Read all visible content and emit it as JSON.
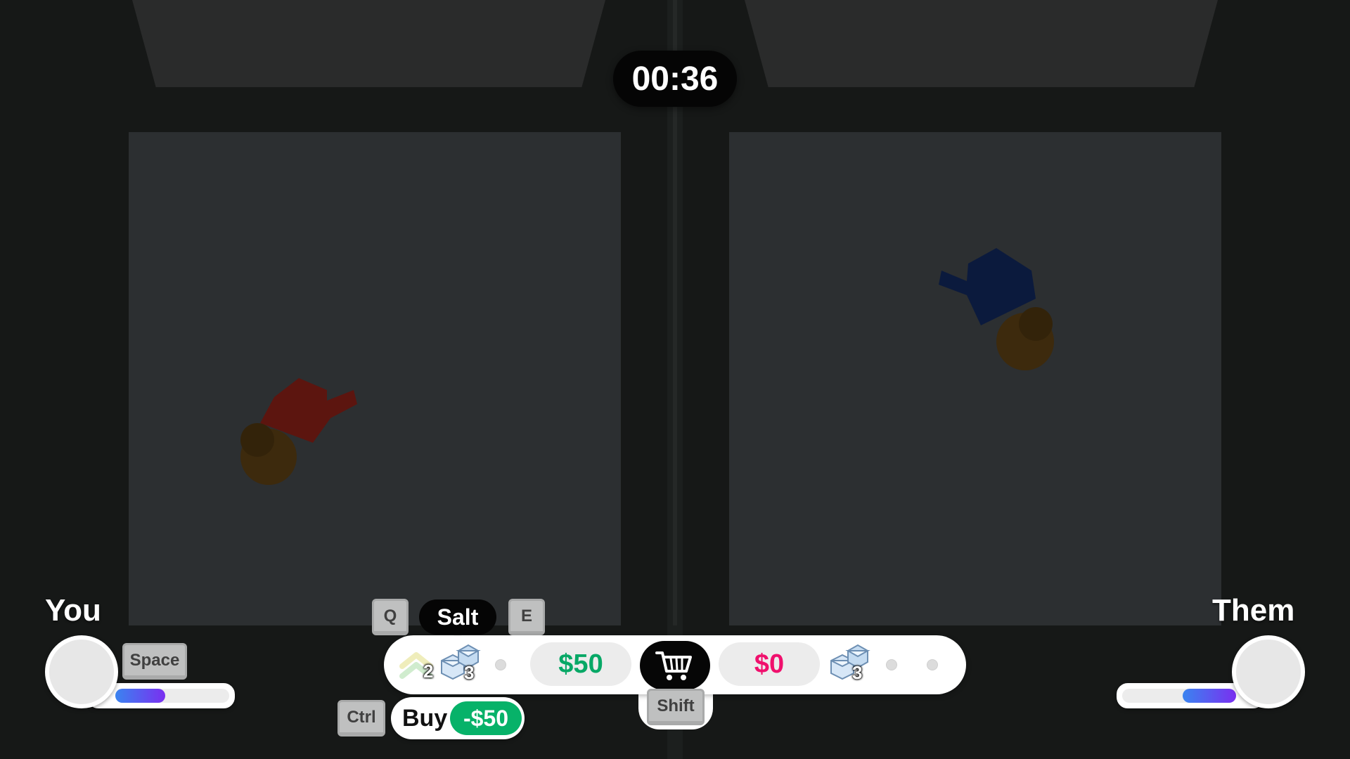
{
  "timer": "00:36",
  "players": {
    "you": {
      "label": "You",
      "meter_fraction": 0.44
    },
    "them": {
      "label": "Them",
      "meter_fraction": 0.47
    }
  },
  "keys": {
    "prev": "Q",
    "next": "E",
    "jump": "Space",
    "buy": "Ctrl",
    "shop": "Shift"
  },
  "selected_item": {
    "name": "Salt"
  },
  "hud": {
    "you_items": [
      {
        "icon": "upgrade-chevrons-icon",
        "count": "2"
      },
      {
        "icon": "salt-crystals-icon",
        "count": "3"
      }
    ],
    "you_money": "$50",
    "them_money": "$0",
    "them_items": [
      {
        "icon": "salt-crystals-icon",
        "count": "3"
      }
    ],
    "cart_icon": "shopping-cart-icon"
  },
  "buy": {
    "label": "Buy",
    "price": "-$50"
  },
  "colors": {
    "you_money": "#07a866",
    "them_money": "#f0106d",
    "buy_price_bg": "#07b269",
    "you_character": "#5c150f",
    "them_character": "#0b1a3d",
    "meter_gradient_start": "#3a84f0",
    "meter_gradient_end": "#7a2ff0"
  }
}
